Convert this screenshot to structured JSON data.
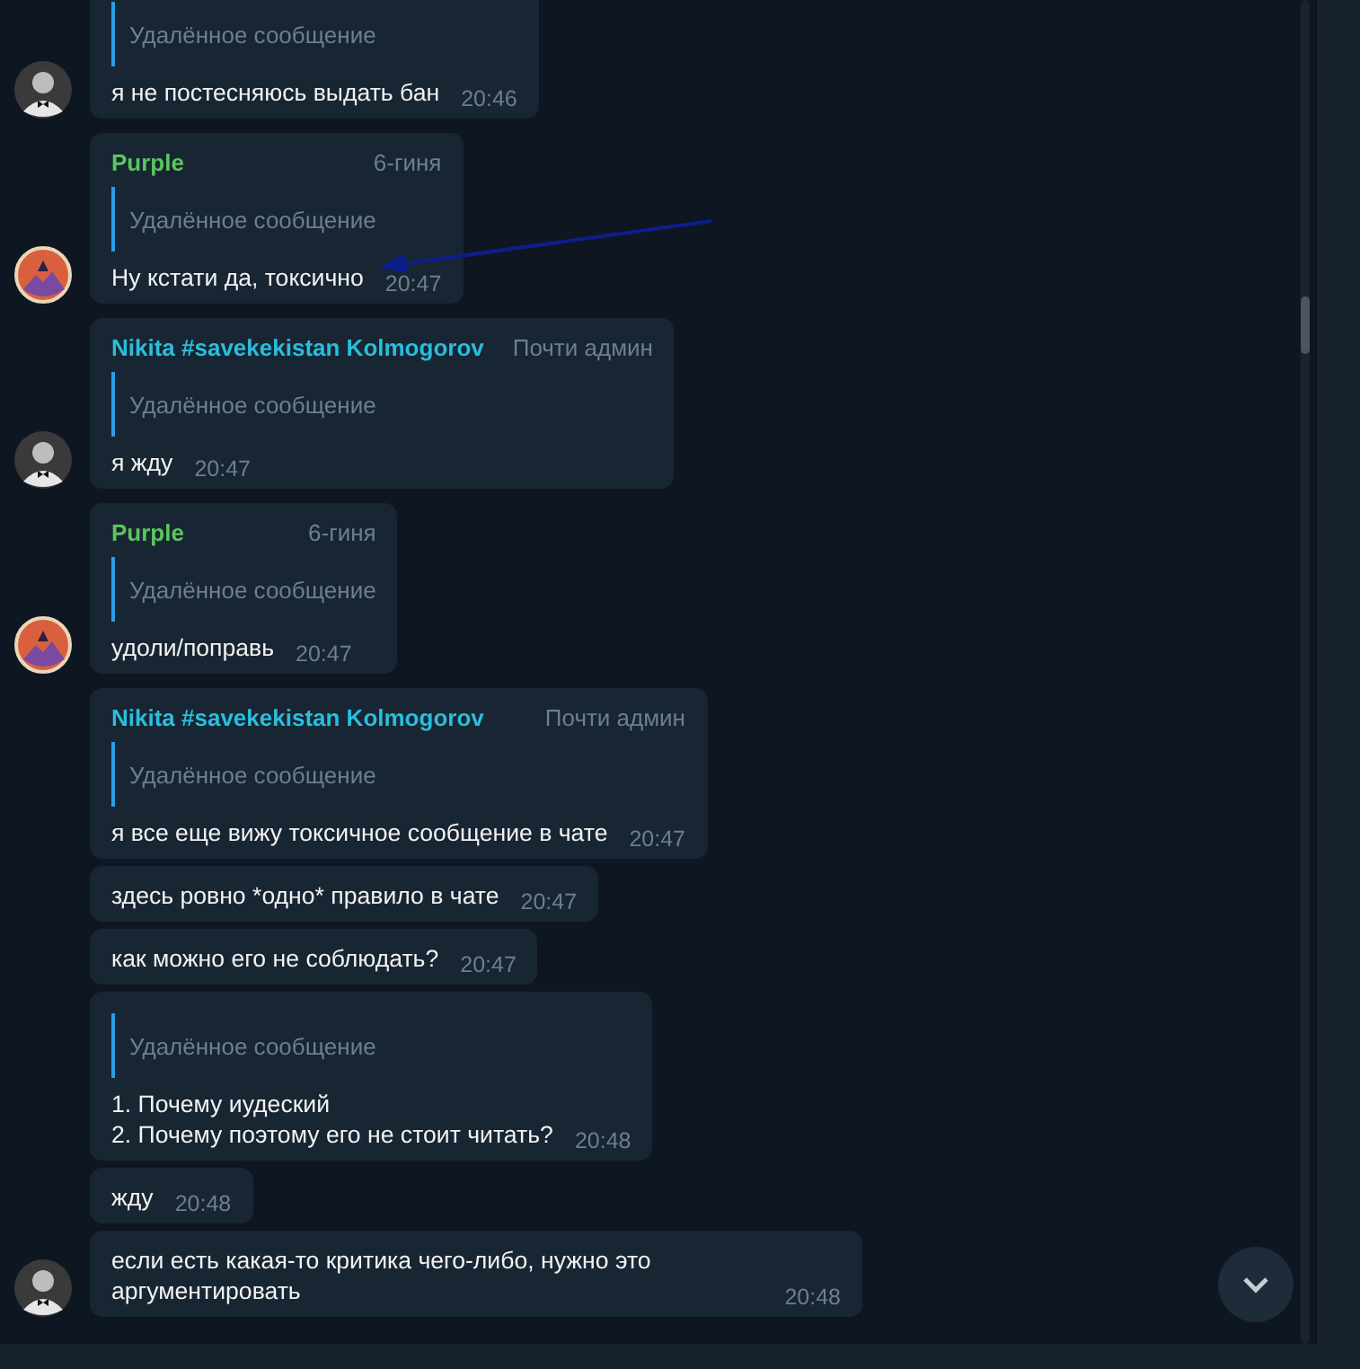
{
  "groups": [
    {
      "avatar": {
        "kind": "photo"
      },
      "messages": [
        {
          "reply": "Удалённое сообщение",
          "text": "я не постесняюсь выдать бан",
          "time": "20:46"
        }
      ]
    },
    {
      "avatar": {
        "kind": "art"
      },
      "messages": [
        {
          "author": "Purple",
          "color": "#5bc55f",
          "badge": "6-гиня",
          "reply": "Удалённое сообщение",
          "text": "Ну кстати да, токсично",
          "time": "20:47"
        }
      ]
    },
    {
      "avatar": {
        "kind": "photo"
      },
      "messages": [
        {
          "author": "Nikita #savekekistan Kolmogorov",
          "color": "#27bfdc",
          "badge": "Почти админ",
          "reply": "Удалённое сообщение",
          "text": "я жду",
          "time": "20:47"
        }
      ]
    },
    {
      "avatar": {
        "kind": "art"
      },
      "messages": [
        {
          "author": "Purple",
          "color": "#5bc55f",
          "badge": "6-гиня",
          "reply": "Удалённое сообщение",
          "text": "удоли/поправь",
          "time": "20:47"
        }
      ]
    },
    {
      "avatar": {
        "kind": "photo"
      },
      "messages": [
        {
          "author": "Nikita #savekekistan Kolmogorov",
          "color": "#27bfdc",
          "badge": "Почти админ",
          "reply": "Удалённое сообщение",
          "text": "я все еще вижу токсичное сообщение в чате",
          "time": "20:47"
        },
        {
          "text": "здесь ровно *одно* правило в чате",
          "time": "20:47"
        },
        {
          "text": "как можно его не соблюдать?",
          "time": "20:47"
        },
        {
          "reply": "Удалённое сообщение",
          "text": "1. Почему иудеский\n2. Почему поэтому его не стоит читать?",
          "time": "20:48"
        },
        {
          "text": "жду",
          "time": "20:48"
        },
        {
          "text": "если есть какая-то критика чего-либо, нужно это аргументировать",
          "time": "20:48"
        }
      ]
    }
  ]
}
